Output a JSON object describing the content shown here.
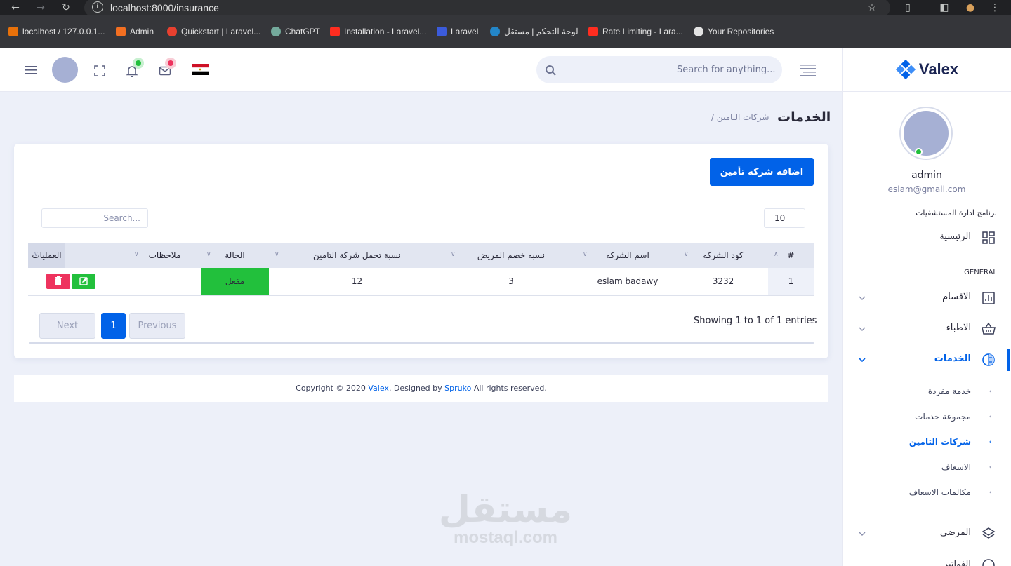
{
  "browser": {
    "url": "localhost:8000/insurance",
    "bookmarks": [
      {
        "label": "localhost / 127.0.0.1...",
        "color": "#e8710a"
      },
      {
        "label": "Admin",
        "color": "#f36f21"
      },
      {
        "label": "Quickstart | Laravel...",
        "color": "#e8402f"
      },
      {
        "label": "ChatGPT",
        "color": "#74aa9c"
      },
      {
        "label": "Installation - Laravel...",
        "color": "#ff2d20"
      },
      {
        "label": "Laravel",
        "color": "#3b5bdb"
      },
      {
        "label": "لوحة التحكم | مستقل",
        "color": "#2386c8"
      },
      {
        "label": "Rate Limiting - Lara...",
        "color": "#ff2d20"
      },
      {
        "label": "Your Repositories",
        "color": "#e3e3e3"
      }
    ]
  },
  "header": {
    "search_placeholder": "Search for anything..."
  },
  "sidebar": {
    "brand": "Valex",
    "user_name": "admin",
    "user_email": "eslam@gmail.com",
    "app_section": "برنامج ادارة المستشفيات",
    "home": "الرئيسية",
    "general_label": "GENERAL",
    "items": [
      {
        "label": "الاقسام"
      },
      {
        "label": "الاطباء"
      },
      {
        "label": "الخدمات"
      }
    ],
    "sub_items": [
      {
        "label": "خدمة مفردة"
      },
      {
        "label": "مجموعة خدمات"
      },
      {
        "label": "شركات التامين"
      },
      {
        "label": "الاسعاف"
      },
      {
        "label": "مكالمات الاسعاف"
      }
    ],
    "patients": "المرضي",
    "partial": "الفواتير"
  },
  "page": {
    "title": "الخدمات",
    "breadcrumb": "/ شركات التامين",
    "add_button": "اضافه شركه تأمين",
    "page_length": "10",
    "search_placeholder": "Search...",
    "columns": [
      "#",
      "كود الشركه",
      "اسم الشركه",
      "نسبه خصم المريض",
      "نسبة تحمل شركة التامين",
      "الحالة",
      "ملاحظات",
      "العمليات"
    ],
    "rows": [
      {
        "index": "1",
        "code": "3232",
        "name": "eslam badawy",
        "patient_discount": "3",
        "company_share": "12",
        "status": "مفعل",
        "notes": ""
      }
    ],
    "showing": "Showing 1 to 1 of 1 entries",
    "prev": "Previous",
    "current_page": "1",
    "next": "Next"
  },
  "footer": {
    "prefix": "Copyright © 2020 ",
    "brand": "Valex",
    "mid": ". Designed by ",
    "designer": "Spruko",
    "suffix": " All rights reserved."
  },
  "watermark": {
    "arabic": "مستقل",
    "latin": "mostaql.com"
  },
  "colors": {
    "primary": "#0162e8",
    "success": "#22c03c",
    "danger": "#ee335e"
  }
}
